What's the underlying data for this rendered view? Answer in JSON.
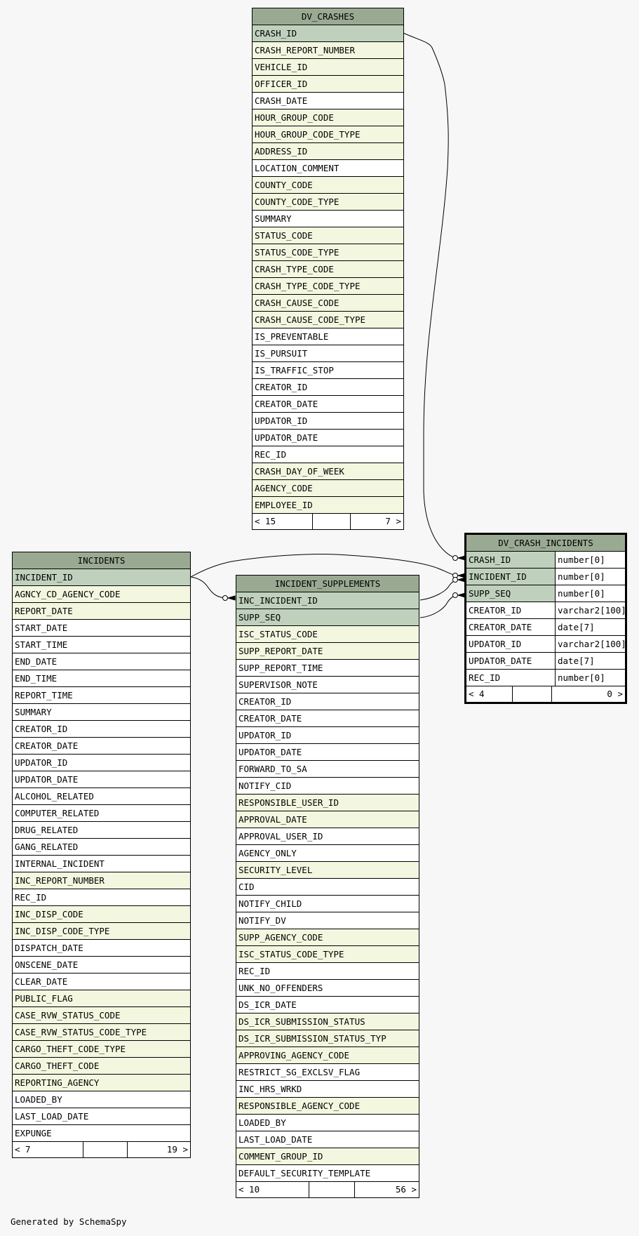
{
  "diagram": {
    "footer": "Generated by SchemaSpy",
    "tables": {
      "dv_crashes": {
        "name": "DV_CRASHES",
        "columns": [
          {
            "name": "CRASH_ID",
            "kind": "pk"
          },
          {
            "name": "CRASH_REPORT_NUMBER",
            "kind": "fk"
          },
          {
            "name": "VEHICLE_ID",
            "kind": "fk"
          },
          {
            "name": "OFFICER_ID",
            "kind": "fk"
          },
          {
            "name": "CRASH_DATE",
            "kind": "plain"
          },
          {
            "name": "HOUR_GROUP_CODE",
            "kind": "fk"
          },
          {
            "name": "HOUR_GROUP_CODE_TYPE",
            "kind": "fk"
          },
          {
            "name": "ADDRESS_ID",
            "kind": "fk"
          },
          {
            "name": "LOCATION_COMMENT",
            "kind": "plain"
          },
          {
            "name": "COUNTY_CODE",
            "kind": "fk"
          },
          {
            "name": "COUNTY_CODE_TYPE",
            "kind": "fk"
          },
          {
            "name": "SUMMARY",
            "kind": "plain"
          },
          {
            "name": "STATUS_CODE",
            "kind": "fk"
          },
          {
            "name": "STATUS_CODE_TYPE",
            "kind": "fk"
          },
          {
            "name": "CRASH_TYPE_CODE",
            "kind": "fk"
          },
          {
            "name": "CRASH_TYPE_CODE_TYPE",
            "kind": "fk"
          },
          {
            "name": "CRASH_CAUSE_CODE",
            "kind": "fk"
          },
          {
            "name": "CRASH_CAUSE_CODE_TYPE",
            "kind": "fk"
          },
          {
            "name": "IS_PREVENTABLE",
            "kind": "plain"
          },
          {
            "name": "IS_PURSUIT",
            "kind": "plain"
          },
          {
            "name": "IS_TRAFFIC_STOP",
            "kind": "plain"
          },
          {
            "name": "CREATOR_ID",
            "kind": "plain"
          },
          {
            "name": "CREATOR_DATE",
            "kind": "plain"
          },
          {
            "name": "UPDATOR_ID",
            "kind": "plain"
          },
          {
            "name": "UPDATOR_DATE",
            "kind": "plain"
          },
          {
            "name": "REC_ID",
            "kind": "plain"
          },
          {
            "name": "CRASH_DAY_OF_WEEK",
            "kind": "fk"
          },
          {
            "name": "AGENCY_CODE",
            "kind": "fk"
          },
          {
            "name": "EMPLOYEE_ID",
            "kind": "fk"
          }
        ],
        "footer_left": "< 15",
        "footer_right": "7 >"
      },
      "dv_crash_incidents": {
        "name": "DV_CRASH_INCIDENTS",
        "columns": [
          {
            "name": "CRASH_ID",
            "type": "number[0]",
            "kind": "pk"
          },
          {
            "name": "INCIDENT_ID",
            "type": "number[0]",
            "kind": "pk"
          },
          {
            "name": "SUPP_SEQ",
            "type": "number[0]",
            "kind": "pk"
          },
          {
            "name": "CREATOR_ID",
            "type": "varchar2[100]",
            "kind": "plain"
          },
          {
            "name": "CREATOR_DATE",
            "type": "date[7]",
            "kind": "plain"
          },
          {
            "name": "UPDATOR_ID",
            "type": "varchar2[100]",
            "kind": "plain"
          },
          {
            "name": "UPDATOR_DATE",
            "type": "date[7]",
            "kind": "plain"
          },
          {
            "name": "REC_ID",
            "type": "number[0]",
            "kind": "plain"
          }
        ],
        "footer_left": "< 4",
        "footer_right": "0 >"
      },
      "incidents": {
        "name": "INCIDENTS",
        "columns": [
          {
            "name": "INCIDENT_ID",
            "kind": "pk"
          },
          {
            "name": "AGNCY_CD_AGENCY_CODE",
            "kind": "fk"
          },
          {
            "name": "REPORT_DATE",
            "kind": "fk"
          },
          {
            "name": "START_DATE",
            "kind": "plain"
          },
          {
            "name": "START_TIME",
            "kind": "plain"
          },
          {
            "name": "END_DATE",
            "kind": "plain"
          },
          {
            "name": "END_TIME",
            "kind": "plain"
          },
          {
            "name": "REPORT_TIME",
            "kind": "plain"
          },
          {
            "name": "SUMMARY",
            "kind": "plain"
          },
          {
            "name": "CREATOR_ID",
            "kind": "plain"
          },
          {
            "name": "CREATOR_DATE",
            "kind": "plain"
          },
          {
            "name": "UPDATOR_ID",
            "kind": "plain"
          },
          {
            "name": "UPDATOR_DATE",
            "kind": "plain"
          },
          {
            "name": "ALCOHOL_RELATED",
            "kind": "plain"
          },
          {
            "name": "COMPUTER_RELATED",
            "kind": "plain"
          },
          {
            "name": "DRUG_RELATED",
            "kind": "plain"
          },
          {
            "name": "GANG_RELATED",
            "kind": "plain"
          },
          {
            "name": "INTERNAL_INCIDENT",
            "kind": "plain"
          },
          {
            "name": "INC_REPORT_NUMBER",
            "kind": "fk"
          },
          {
            "name": "REC_ID",
            "kind": "plain"
          },
          {
            "name": "INC_DISP_CODE",
            "kind": "fk"
          },
          {
            "name": "INC_DISP_CODE_TYPE",
            "kind": "fk"
          },
          {
            "name": "DISPATCH_DATE",
            "kind": "plain"
          },
          {
            "name": "ONSCENE_DATE",
            "kind": "plain"
          },
          {
            "name": "CLEAR_DATE",
            "kind": "plain"
          },
          {
            "name": "PUBLIC_FLAG",
            "kind": "fk"
          },
          {
            "name": "CASE_RVW_STATUS_CODE",
            "kind": "fk"
          },
          {
            "name": "CASE_RVW_STATUS_CODE_TYPE",
            "kind": "fk"
          },
          {
            "name": "CARGO_THEFT_CODE_TYPE",
            "kind": "fk"
          },
          {
            "name": "CARGO_THEFT_CODE",
            "kind": "fk"
          },
          {
            "name": "REPORTING_AGENCY",
            "kind": "fk"
          },
          {
            "name": "LOADED_BY",
            "kind": "plain"
          },
          {
            "name": "LAST_LOAD_DATE",
            "kind": "plain"
          },
          {
            "name": "EXPUNGE",
            "kind": "plain"
          }
        ],
        "footer_left": "< 7",
        "footer_right": "19 >"
      },
      "incident_supplements": {
        "name": "INCIDENT_SUPPLEMENTS",
        "columns": [
          {
            "name": "INC_INCIDENT_ID",
            "kind": "pk"
          },
          {
            "name": "SUPP_SEQ",
            "kind": "pk"
          },
          {
            "name": "ISC_STATUS_CODE",
            "kind": "fk"
          },
          {
            "name": "SUPP_REPORT_DATE",
            "kind": "fk"
          },
          {
            "name": "SUPP_REPORT_TIME",
            "kind": "plain"
          },
          {
            "name": "SUPERVISOR_NOTE",
            "kind": "plain"
          },
          {
            "name": "CREATOR_ID",
            "kind": "plain"
          },
          {
            "name": "CREATOR_DATE",
            "kind": "plain"
          },
          {
            "name": "UPDATOR_ID",
            "kind": "plain"
          },
          {
            "name": "UPDATOR_DATE",
            "kind": "plain"
          },
          {
            "name": "FORWARD_TO_SA",
            "kind": "plain"
          },
          {
            "name": "NOTIFY_CID",
            "kind": "plain"
          },
          {
            "name": "RESPONSIBLE_USER_ID",
            "kind": "fk"
          },
          {
            "name": "APPROVAL_DATE",
            "kind": "fk"
          },
          {
            "name": "APPROVAL_USER_ID",
            "kind": "plain"
          },
          {
            "name": "AGENCY_ONLY",
            "kind": "plain"
          },
          {
            "name": "SECURITY_LEVEL",
            "kind": "fk"
          },
          {
            "name": "CID",
            "kind": "plain"
          },
          {
            "name": "NOTIFY_CHILD",
            "kind": "plain"
          },
          {
            "name": "NOTIFY_DV",
            "kind": "plain"
          },
          {
            "name": "SUPP_AGENCY_CODE",
            "kind": "fk"
          },
          {
            "name": "ISC_STATUS_CODE_TYPE",
            "kind": "fk"
          },
          {
            "name": "REC_ID",
            "kind": "plain"
          },
          {
            "name": "UNK_NO_OFFENDERS",
            "kind": "plain"
          },
          {
            "name": "DS_ICR_DATE",
            "kind": "plain"
          },
          {
            "name": "DS_ICR_SUBMISSION_STATUS",
            "kind": "fk"
          },
          {
            "name": "DS_ICR_SUBMISSION_STATUS_TYP",
            "kind": "fk"
          },
          {
            "name": "APPROVING_AGENCY_CODE",
            "kind": "fk"
          },
          {
            "name": "RESTRICT_SG_EXCLSV_FLAG",
            "kind": "plain"
          },
          {
            "name": "INC_HRS_WRKD",
            "kind": "plain"
          },
          {
            "name": "RESPONSIBLE_AGENCY_CODE",
            "kind": "fk"
          },
          {
            "name": "LOADED_BY",
            "kind": "plain"
          },
          {
            "name": "LAST_LOAD_DATE",
            "kind": "plain"
          },
          {
            "name": "COMMENT_GROUP_ID",
            "kind": "fk"
          },
          {
            "name": "DEFAULT_SECURITY_TEMPLATE",
            "kind": "plain"
          }
        ],
        "footer_left": "< 10",
        "footer_right": "56 >"
      }
    },
    "relationships": [
      {
        "from": "dv_crashes.CRASH_ID",
        "to": "dv_crash_incidents.CRASH_ID"
      },
      {
        "from": "incidents.INCIDENT_ID",
        "to": "dv_crash_incidents.INCIDENT_ID"
      },
      {
        "from": "incidents.INCIDENT_ID",
        "to": "incident_supplements.INC_INCIDENT_ID"
      },
      {
        "from": "incident_supplements.INC_INCIDENT_ID",
        "to": "dv_crash_incidents.INCIDENT_ID"
      },
      {
        "from": "incident_supplements.SUPP_SEQ",
        "to": "dv_crash_incidents.SUPP_SEQ"
      }
    ]
  }
}
